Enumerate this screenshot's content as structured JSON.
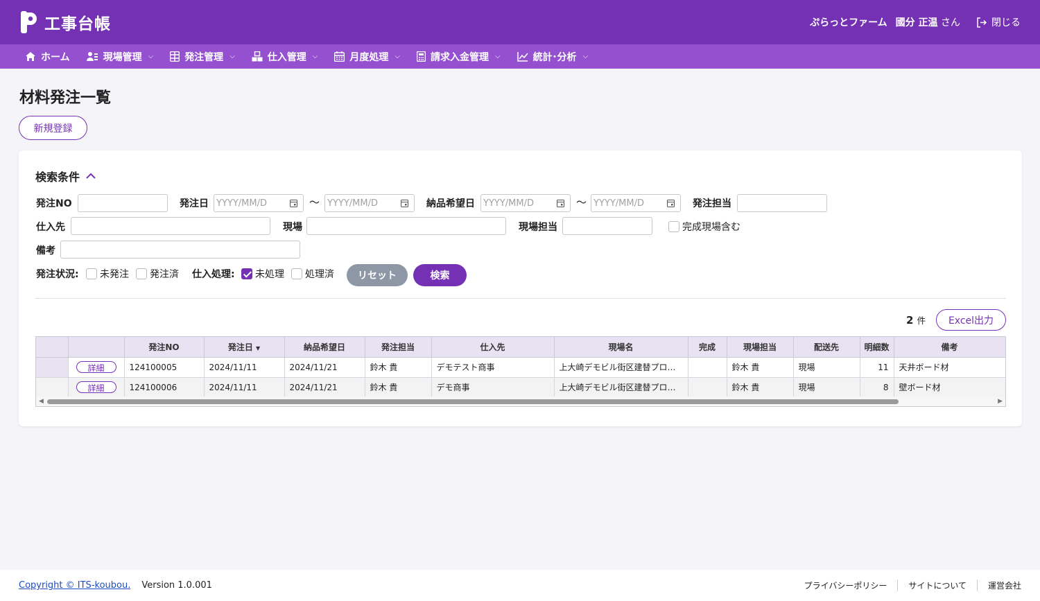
{
  "header": {
    "app_title": "工事台帳",
    "company": "ぷらっとファーム",
    "user_name": "國分 正温",
    "user_suffix": "さん",
    "logout_label": "閉じる"
  },
  "nav": [
    {
      "label": "ホーム",
      "icon": "home-icon"
    },
    {
      "label": "現場管理",
      "icon": "worker-icon"
    },
    {
      "label": "発注管理",
      "icon": "grid-icon"
    },
    {
      "label": "仕入管理",
      "icon": "boxes-icon"
    },
    {
      "label": "月度処理",
      "icon": "calendar-icon"
    },
    {
      "label": "請求入金管理",
      "icon": "calculator-icon"
    },
    {
      "label": "統計･分析",
      "icon": "chart-icon"
    }
  ],
  "page": {
    "title": "材料発注一覧",
    "new_button": "新規登録"
  },
  "search": {
    "title": "検索条件",
    "order_no_label": "発注NO",
    "order_date_label": "発注日",
    "delivery_date_label": "納品希望日",
    "order_staff_label": "発注担当",
    "supplier_label": "仕入先",
    "site_label": "現場",
    "site_staff_label": "現場担当",
    "include_completed_label": "完成現場含む",
    "remarks_label": "備考",
    "date_placeholder": "YYYY/MM/D",
    "tilde": "～",
    "order_status_label": "発注状況:",
    "not_ordered_label": "未発注",
    "ordered_label": "発注済",
    "purchase_label": "仕入処理:",
    "unprocessed_label": "未処理",
    "processed_label": "処理済",
    "reset_button": "リセット",
    "search_button": "検索"
  },
  "results": {
    "count": "2",
    "count_unit": "件",
    "excel_button": "Excel出力",
    "detail_label": "詳細",
    "sort_indicator": "▼",
    "columns": [
      "発注NO",
      "発注日",
      "納品希望日",
      "発注担当",
      "仕入先",
      "現場名",
      "完成",
      "現場担当",
      "配送先",
      "明細数",
      "備考"
    ],
    "rows": [
      {
        "order_no": "124100005",
        "order_date": "2024/11/11",
        "delivery_date": "2024/11/21",
        "order_staff": "鈴木 貴",
        "supplier": "デモテスト商事",
        "site": "上大崎デモビル街区建替プロ…",
        "completed": "",
        "site_staff": "鈴木 貴",
        "delivery_to": "現場",
        "lines": "11",
        "remarks": "天井ボード材"
      },
      {
        "order_no": "124100006",
        "order_date": "2024/11/11",
        "delivery_date": "2024/11/21",
        "order_staff": "鈴木 貴",
        "supplier": "デモ商事",
        "site": "上大崎デモビル街区建替プロ…",
        "completed": "",
        "site_staff": "鈴木 貴",
        "delivery_to": "現場",
        "lines": "8",
        "remarks": "壁ボード材"
      }
    ]
  },
  "footer": {
    "copyright": "Copyright © ITS-koubou.",
    "version": "Version 1.0.001",
    "links": [
      "プライバシーポリシー",
      "サイトについて",
      "運営会社"
    ]
  },
  "colors": {
    "header": "#7531b3",
    "nav": "#9450cf",
    "accent": "#7531b3",
    "reset_button": "#8e97a6"
  }
}
